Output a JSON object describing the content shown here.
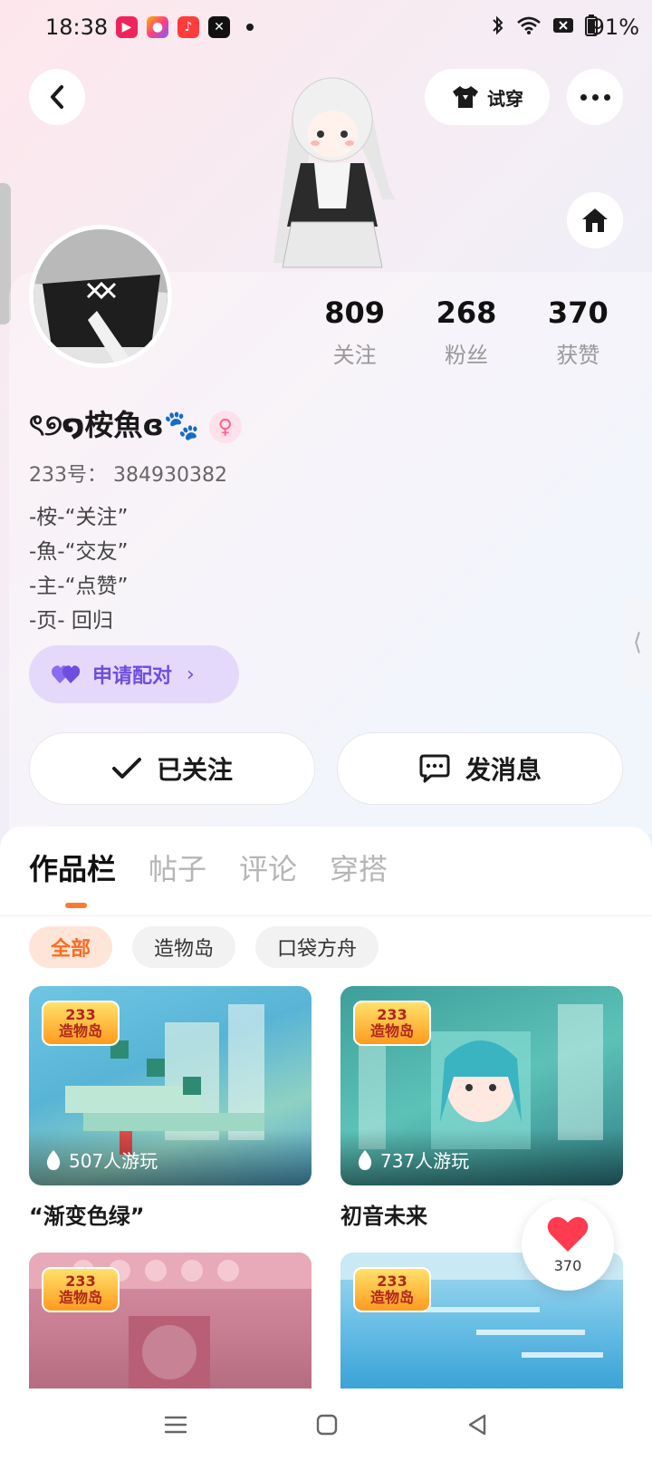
{
  "status_bar": {
    "time": "18:38",
    "battery": "91%",
    "app_icons": [
      "app-icon-red",
      "app-icon-colorful",
      "app-icon-music",
      "app-icon-capcut"
    ]
  },
  "header": {
    "tryon_label": "试穿"
  },
  "profile": {
    "stats": [
      {
        "value": "809",
        "label": "关注"
      },
      {
        "value": "268",
        "label": "粉丝"
      },
      {
        "value": "370",
        "label": "获赞"
      }
    ],
    "nickname": "ৎ୭໑桉魚ɞ🐾",
    "gender_symbol": "♀",
    "uid": "233号： 384930382",
    "bio": [
      "-桉-“关注”",
      "-魚-“交友”",
      "-主-“点赞”",
      "-页- 回归"
    ],
    "pair_label": "申请配对",
    "follow_label": "已关注",
    "message_label": "发消息"
  },
  "content": {
    "tabs": [
      "作品栏",
      "帖子",
      "评论",
      "穿搭"
    ],
    "active_tab": "作品栏",
    "chips": [
      "全部",
      "造物岛",
      "口袋方舟"
    ],
    "badge_number": "233",
    "badge_text": "造物岛",
    "cards": [
      {
        "title": "“渐变色绿”",
        "plays": "507人游玩"
      },
      {
        "title": "初音未来",
        "plays": "737人游玩"
      },
      {
        "title": "",
        "plays": ""
      },
      {
        "title": "",
        "plays": ""
      }
    ]
  },
  "like_fab": {
    "count": "370"
  },
  "colors": {
    "accent": "#ff7a2e",
    "pair_purple": "#6d4ee0",
    "heart_red": "#ff3b4f"
  }
}
